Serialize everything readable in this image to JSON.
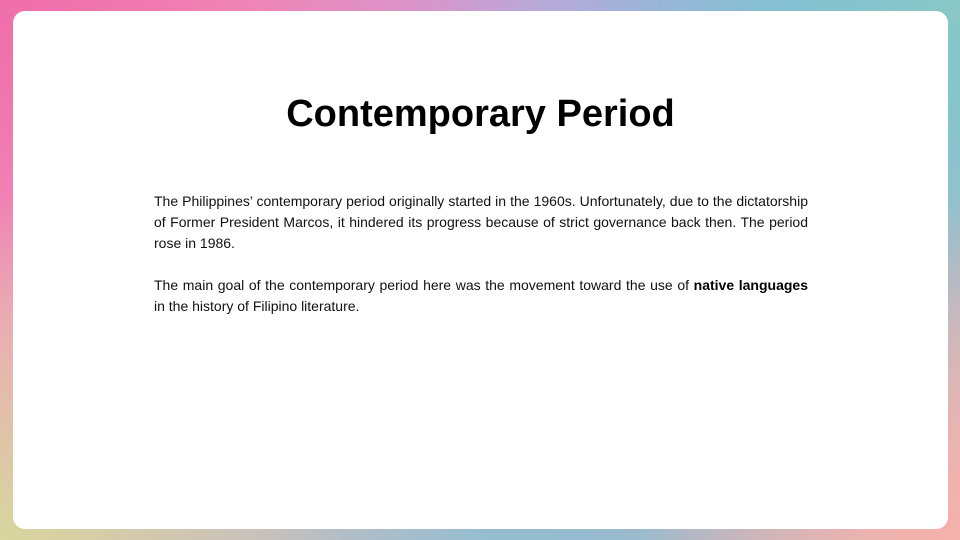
{
  "slide": {
    "title": "Contemporary Period",
    "paragraph_1": "The Philippines’ contemporary period originally started in the 1960s. Unfortunately, due to the dictatorship of Former President Marcos, it hindered its progress because of strict governance back then. The period rose in 1986.",
    "paragraph_2": {
      "before_bold": "The main goal of the contemporary period here was the movement toward the use of ",
      "bold": "native languages",
      "after_bold": " in the history of Filipino literature."
    }
  },
  "colors": {
    "card_background": "#ffffff",
    "title_text": "#000000",
    "body_text": "#111111",
    "border_pink": "#f07ab0",
    "border_blue": "#57c3e6",
    "border_peach": "#f3b7b0",
    "border_lime": "#d6e096"
  }
}
